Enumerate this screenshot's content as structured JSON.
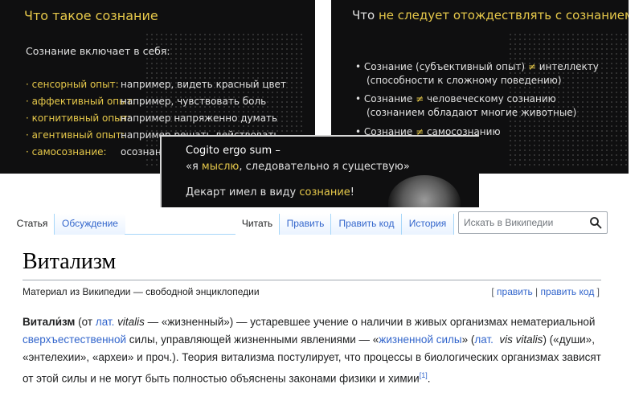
{
  "slide1": {
    "title": "Что такое сознание",
    "intro": "Сознание включает в себя:",
    "items": [
      {
        "term": "сенсорный опыт:",
        "desc": "например, видеть красный цвет"
      },
      {
        "term": "аффективный опыт:",
        "desc": "например, чувствовать боль"
      },
      {
        "term": "когнитивный опыт:",
        "desc": "например напряженно думать"
      },
      {
        "term": "агентивный опыт:",
        "desc": "например решать действовать"
      },
      {
        "term": "самосознание:",
        "desc": "осознани"
      }
    ]
  },
  "slide2": {
    "title_a": "Что ",
    "title_b": "не",
    "title_c": " следует отождествлять с сознанием",
    "items": [
      {
        "line1_a": "Сознание (субъективный опыт) ",
        "neq": "≠",
        "line1_b": " интеллекту",
        "line2": "(способности к сложному поведению)"
      },
      {
        "line1_a": "Сознание ",
        "neq": "≠",
        "line1_b": " человеческому сознанию",
        "line2": "(сознанием обладают многие животные)"
      },
      {
        "line1_a": "Сознание ",
        "neq": "≠",
        "line1_b": " самосознанию",
        "line2": ""
      }
    ]
  },
  "slide3": {
    "line1": "Cogito ergo sum –",
    "line2_a": "«я ",
    "line2_b": "мыслю",
    "line2_c": ", следовательно я существую»",
    "line3_a": "Декарт имел в виду ",
    "line3_b": "сознание",
    "line3_c": "!"
  },
  "wiki": {
    "tabs_left": [
      "Статья",
      "Обсуждение"
    ],
    "tabs_right": [
      "Читать",
      "Править",
      "Править код",
      "История"
    ],
    "search_placeholder": "Искать в Википедии",
    "title": "Витализм",
    "tagline": "Материал из Википедии — свободной энциклопедии",
    "edit_open": "[ ",
    "edit_link1": "править",
    "edit_sep": " | ",
    "edit_link2": "править код",
    "edit_close": " ]",
    "para": {
      "bold": "Витали́зм",
      "t1": " (от ",
      "l1": "лат.",
      "t2": " ",
      "i1": "vitalis",
      "t3": " — «жизненный») — устаревшее учение о наличии в живых организмах нематериальной ",
      "l2": "сверхъестественной",
      "t4": " силы, управляющей жизненными явлениями — «",
      "l3": "жизненной силы",
      "t5": "» (",
      "l4": "лат.",
      "t6": "  ",
      "i2": "vis vitalis",
      "t7": ") («души», «энтелехии», «археи» и проч.). Теория витализма постулирует, что процессы в биологических организмах зависят от этой силы и не могут быть полностью объяснены законами физики и химии",
      "ref": "[1]",
      "t8": "."
    }
  },
  "colors": {
    "accent": "#e6c84a",
    "link": "#3366cc",
    "slide_bg": "#0f0f10"
  },
  "icons": {
    "search": "search-icon"
  }
}
